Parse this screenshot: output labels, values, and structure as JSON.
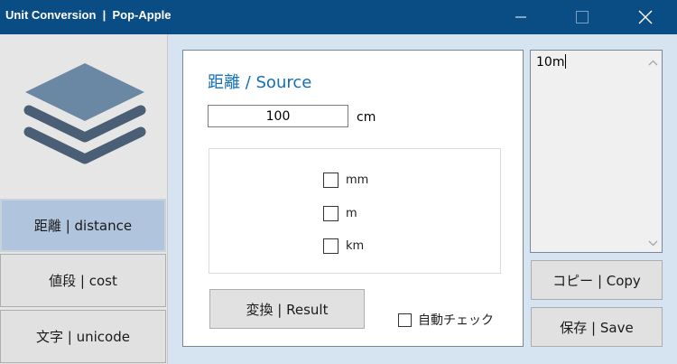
{
  "window": {
    "title": "Unit Conversion  |  Pop-Apple",
    "minimize_icon": "minimize-icon",
    "maximize_icon": "maximize-icon",
    "close_icon": "close-icon",
    "titlebar_color": "#0a4c84"
  },
  "sidebar": {
    "logo_icon": "layers-icon",
    "items": [
      {
        "label": "距離 | distance",
        "active": true
      },
      {
        "label": "値段 | cost",
        "active": false
      },
      {
        "label": "文字 | unicode",
        "active": false
      }
    ],
    "active_color": "#b0c4de"
  },
  "main": {
    "title": "距離 / Source",
    "title_color": "#1170b6",
    "input": {
      "value": "100",
      "unit": "cm"
    },
    "options": [
      {
        "label": "mm",
        "checked": false
      },
      {
        "label": "m",
        "checked": false
      },
      {
        "label": "km",
        "checked": false
      }
    ],
    "result_button": "変換 | Result",
    "auto_check": {
      "label": "自動チェック",
      "checked": false
    }
  },
  "output": {
    "text": "10m",
    "copy_button": "コピー | Copy",
    "save_button": "保存 | Save"
  }
}
